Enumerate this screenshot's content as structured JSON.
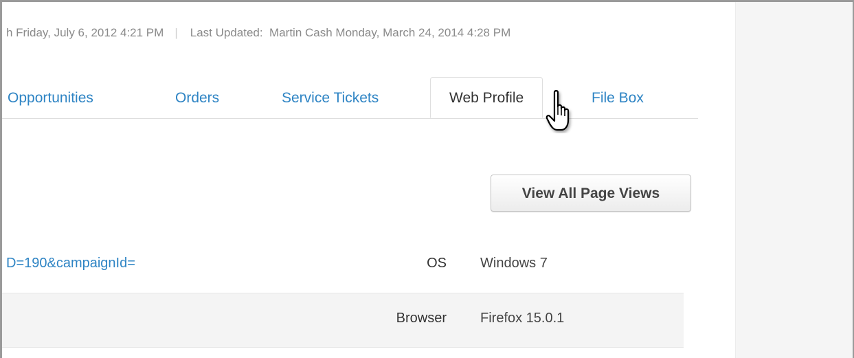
{
  "header": {
    "created_fragment": "h Friday, July 6, 2012 4:21 PM",
    "separator": "|",
    "last_updated_label": "Last Updated:",
    "last_updated_value": "Martin Cash Monday, March 24, 2014 4:28 PM"
  },
  "tabs": [
    {
      "label": "Opportunities",
      "active": false
    },
    {
      "label": "Orders",
      "active": false
    },
    {
      "label": "Service Tickets",
      "active": false
    },
    {
      "label": "Web Profile",
      "active": true
    },
    {
      "label": "File Box",
      "active": false
    }
  ],
  "actions": {
    "view_all_label": "View All Page Views"
  },
  "details": [
    {
      "url_fragment": "D=190&campaignId=",
      "label": "OS",
      "value": "Windows 7"
    },
    {
      "url_fragment": "",
      "label": "Browser",
      "value": "Firefox 15.0.1"
    }
  ],
  "icons": {
    "cursor": "hand-pointer-icon"
  },
  "colors": {
    "link": "#2e84c4",
    "text": "#333333",
    "muted": "#8a8a8a",
    "row_alt": "#f4f4f4",
    "side_panel": "#f5f5f5"
  }
}
